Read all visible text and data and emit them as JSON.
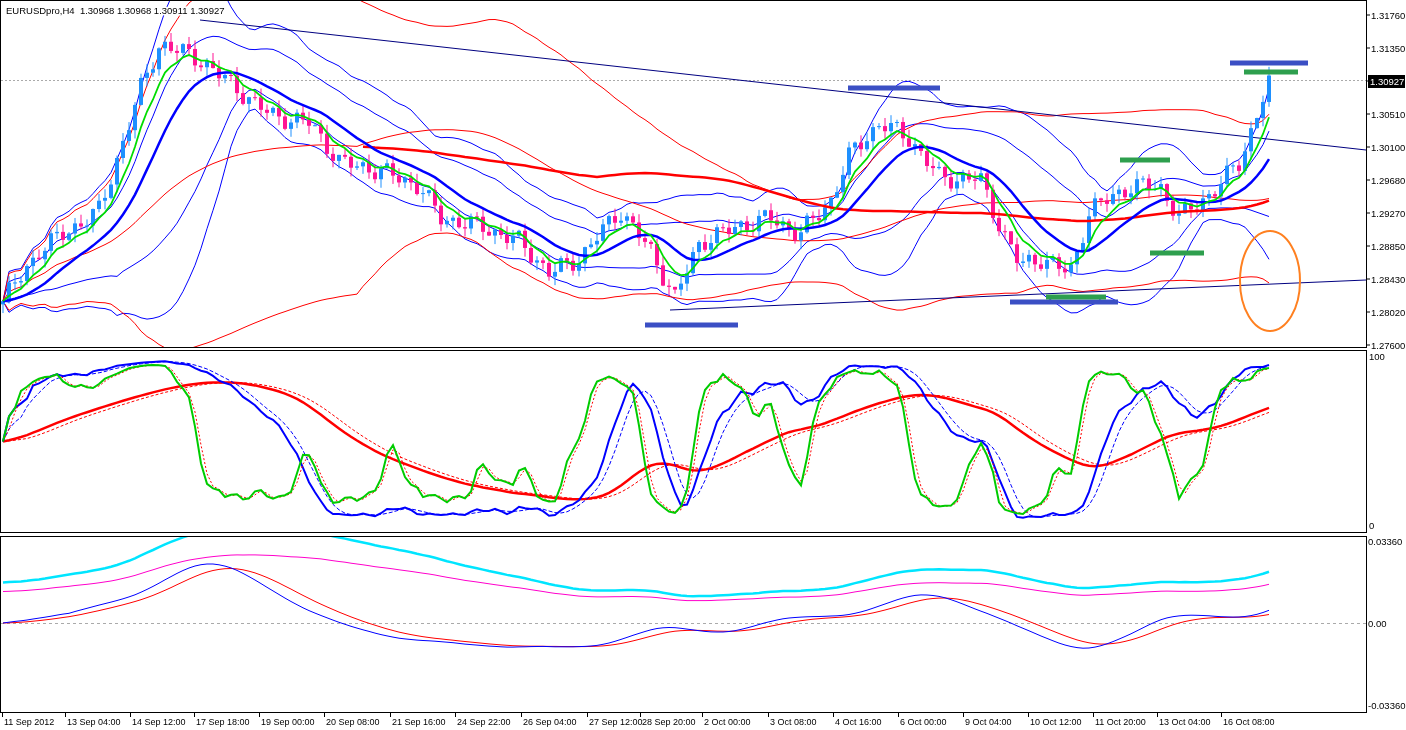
{
  "chart_header": {
    "symbol": "EURUSDpro,H4",
    "quotes": [
      "1.30968",
      "1.30968",
      "1.30911",
      "1.30927"
    ]
  },
  "price_axis": [
    {
      "text": "1.31760",
      "kind": "tick"
    },
    {
      "text": "1.31350",
      "kind": "tick"
    },
    {
      "text": "1.30927",
      "kind": "current"
    },
    {
      "text": "1.30510",
      "kind": "tick"
    },
    {
      "text": "1.30100",
      "kind": "tick"
    },
    {
      "text": "1.29680",
      "kind": "tick"
    },
    {
      "text": "1.29270",
      "kind": "tick"
    },
    {
      "text": "1.28850",
      "kind": "tick"
    },
    {
      "text": "1.28430",
      "kind": "tick"
    },
    {
      "text": "1.28020",
      "kind": "tick"
    },
    {
      "text": "1.27600",
      "kind": "tick"
    }
  ],
  "oscillator_axis": [
    "100",
    "0"
  ],
  "macd_axis": [
    "0.03360",
    "0.00",
    "-0.03360"
  ],
  "time_axis": [
    "11 Sep 2012",
    "13 Sep 04:00",
    "14 Sep 12:00",
    "17 Sep 18:00",
    "19 Sep 00:00",
    "20 Sep 08:00",
    "21 Sep 16:00",
    "24 Sep 22:00",
    "26 Sep 04:00",
    "27 Sep 12:00",
    "28 Sep 20:00",
    "2 Oct 00:00",
    "3 Oct 08:00",
    "4 Oct 16:00",
    "6 Oct 00:00",
    "9 Oct 04:00",
    "10 Oct 12:00",
    "11 Oct 20:00",
    "13 Oct 04:00",
    "16 Oct 08:00"
  ]
}
